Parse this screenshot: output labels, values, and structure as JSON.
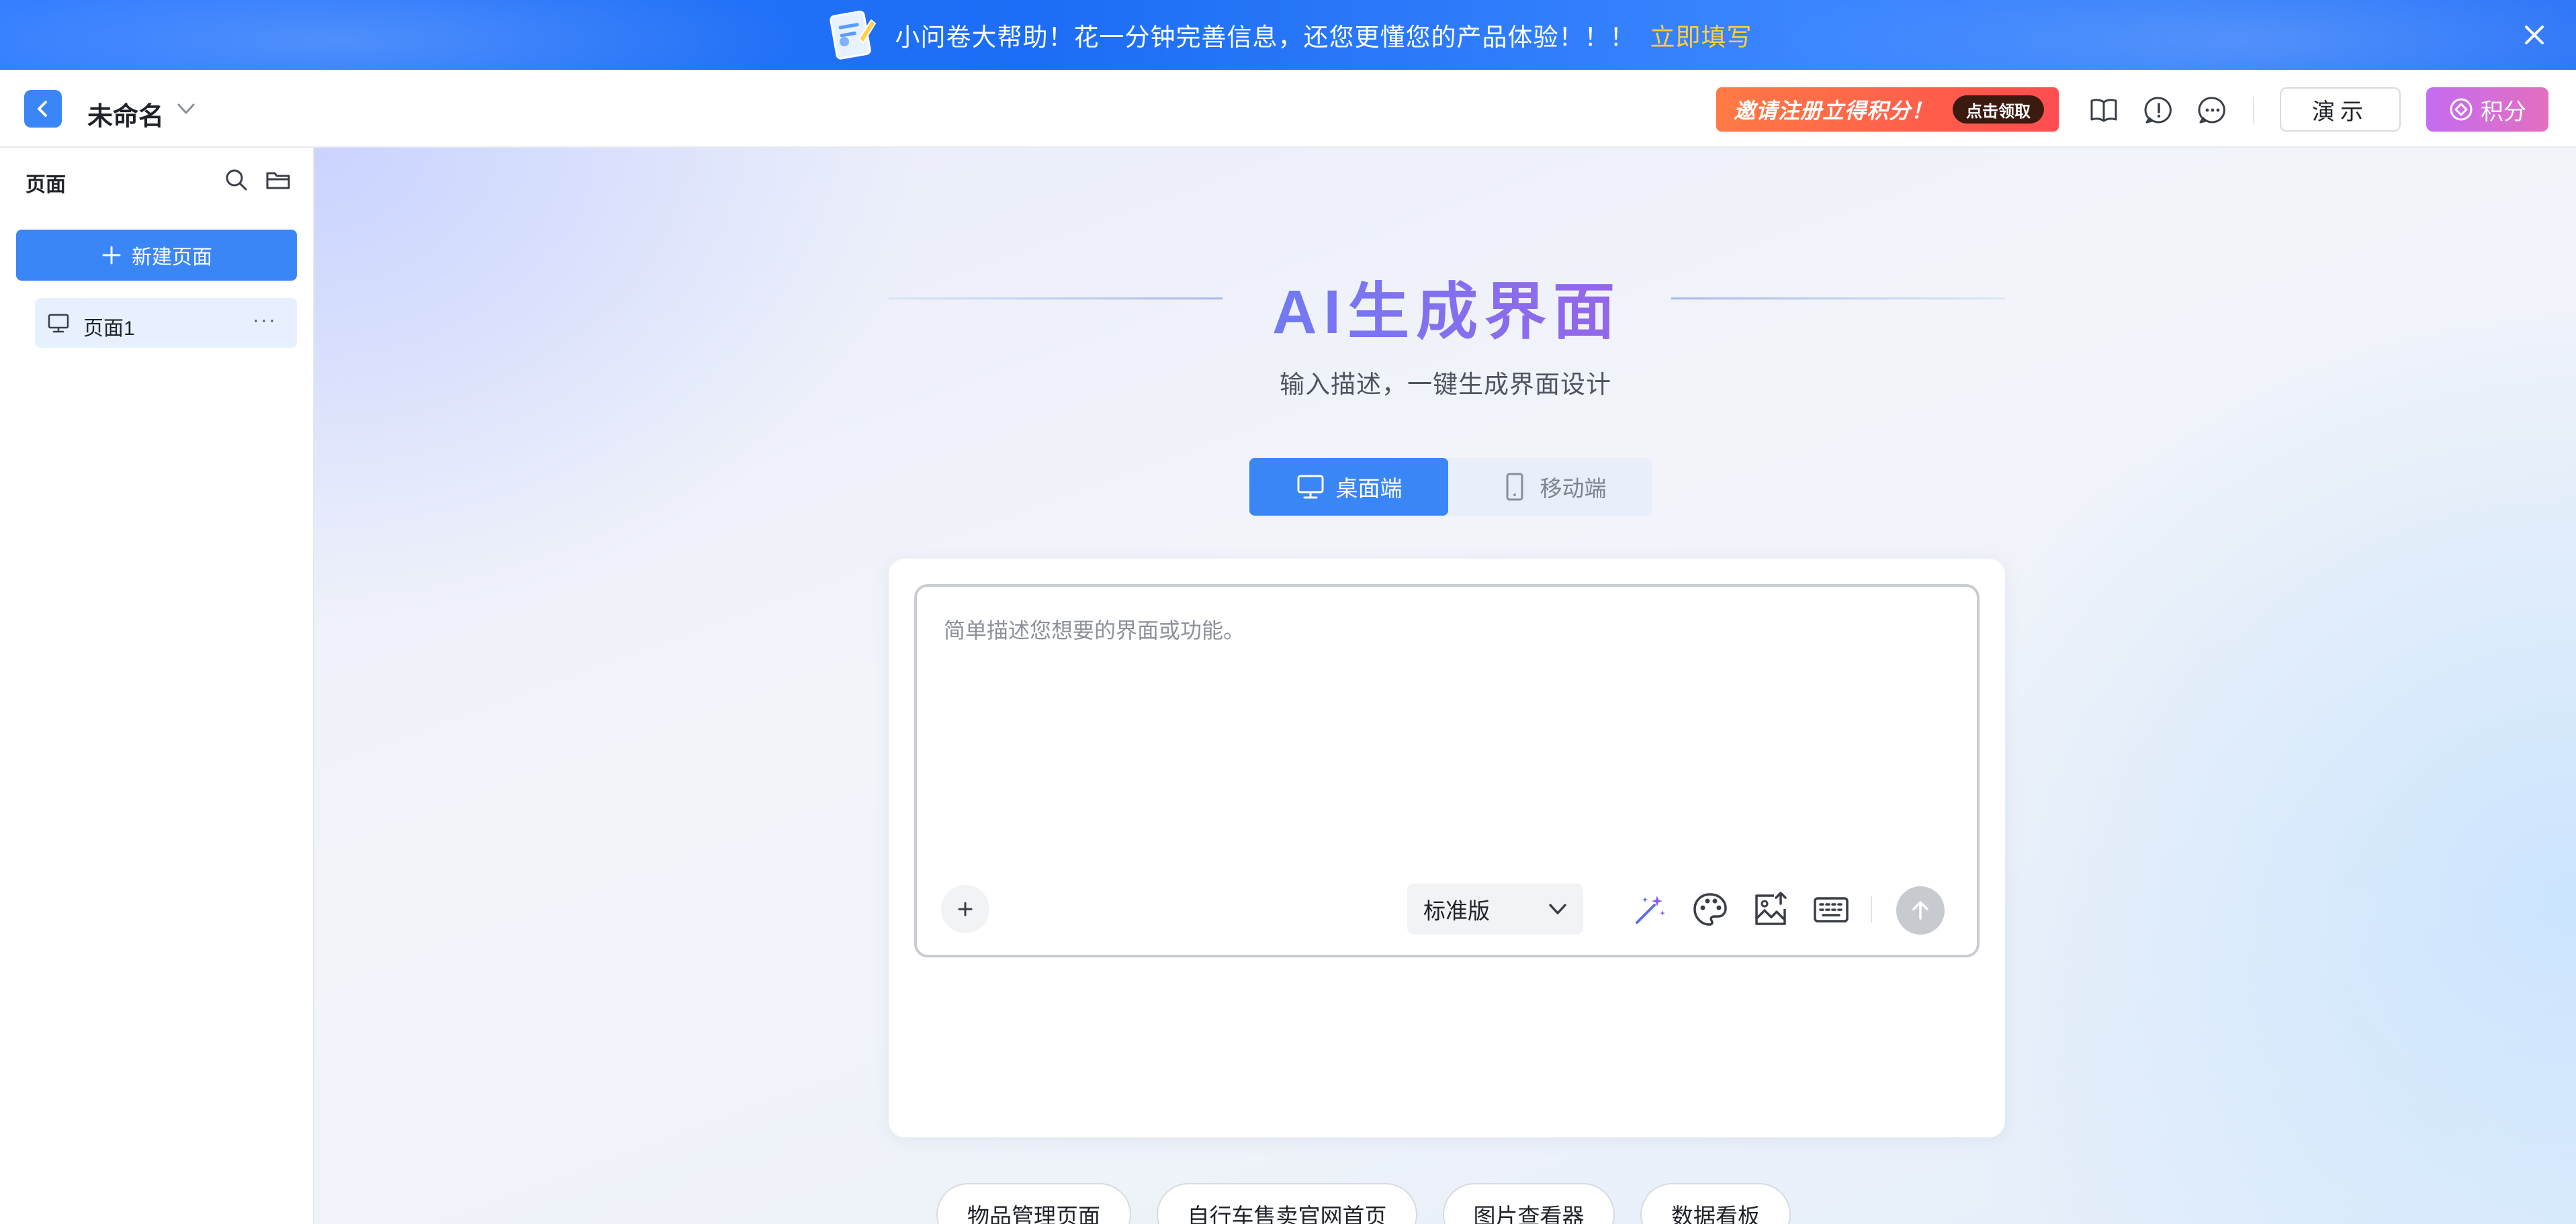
{
  "banner": {
    "text": "小问卷大帮助！花一分钟完善信息，还您更懂您的产品体验！！！",
    "link": "立即填写"
  },
  "header": {
    "title": "未命名",
    "promo_text": "邀请注册立得积分！",
    "promo_badge": "点击领取",
    "demo_label": "演示",
    "points_label": "积分"
  },
  "sidebar": {
    "title": "页面",
    "new_page_label": "新建页面",
    "pages": [
      {
        "label": "页面1",
        "more": "···"
      }
    ]
  },
  "main": {
    "title": "AI生成界面",
    "subtitle": "输入描述，一键生成界面设计",
    "tabs": [
      {
        "label": "桌面端",
        "active": true
      },
      {
        "label": "移动端",
        "active": false
      }
    ],
    "prompt_placeholder": "简单描述您想要的界面或功能。",
    "version": "标准版",
    "suggestions": [
      "物品管理页面",
      "自行车售卖官网首页",
      "图片查看器",
      "数据看板"
    ]
  },
  "colors": {
    "primary": "#3a86f7",
    "banner_link": "#ffcf3d",
    "promo": "#ff4d4f",
    "points": "#c46cf2"
  },
  "icons": {
    "back": "chevron-left-icon",
    "close": "close-icon",
    "book": "book-icon",
    "feedback": "alert-circle-icon",
    "chat": "chat-icon",
    "search": "search-icon",
    "folder": "folder-icon",
    "desktop": "monitor-icon",
    "mobile": "mobile-icon",
    "magic": "magic-wand-icon",
    "palette": "palette-icon",
    "image_upload": "image-upload-icon",
    "keyboard": "keyboard-icon",
    "send": "arrow-up-icon"
  }
}
